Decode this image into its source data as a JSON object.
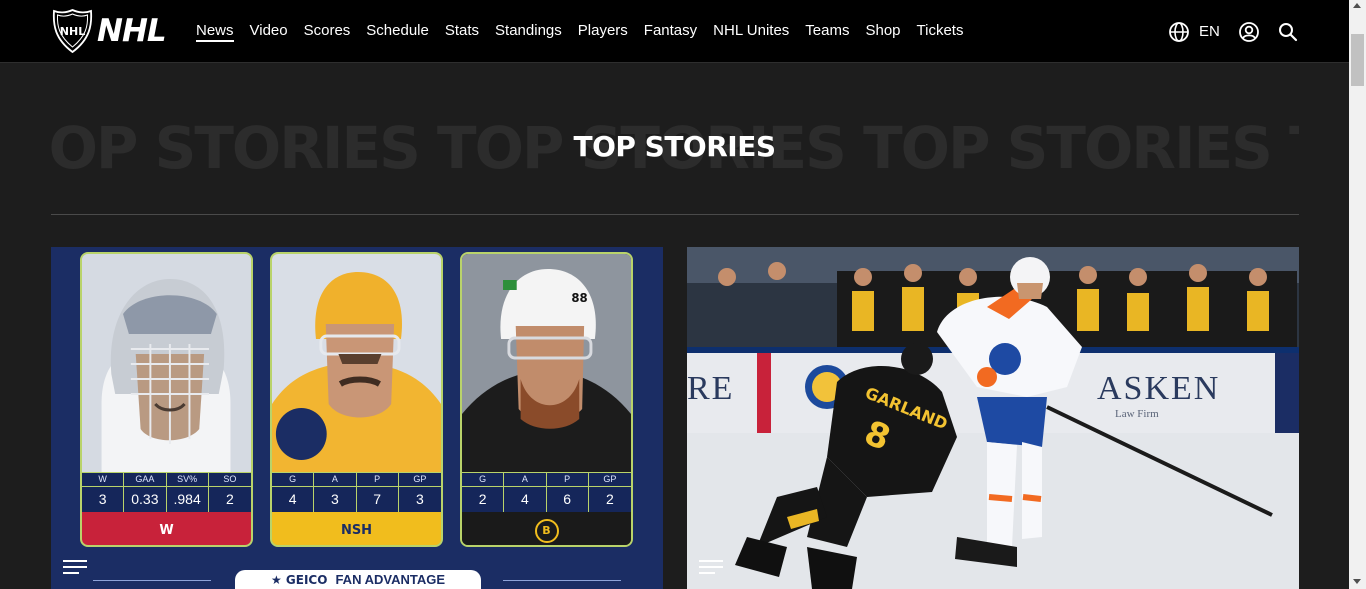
{
  "header": {
    "logo_text": "NHL",
    "nav": [
      {
        "label": "News",
        "active": true
      },
      {
        "label": "Video"
      },
      {
        "label": "Scores"
      },
      {
        "label": "Schedule"
      },
      {
        "label": "Stats"
      },
      {
        "label": "Standings"
      },
      {
        "label": "Players"
      },
      {
        "label": "Fantasy"
      },
      {
        "label": "NHL Unites"
      },
      {
        "label": "Teams"
      },
      {
        "label": "Shop"
      },
      {
        "label": "Tickets"
      }
    ],
    "language": "EN",
    "icons": {
      "language": "globe-icon",
      "account": "user-circle-icon",
      "search": "search-icon"
    }
  },
  "section": {
    "title": "TOP STORIES",
    "background_text": "TOP STORIES TOP STORIES TOP STORIES TOP STORIES"
  },
  "cards": [
    {
      "type": "graphic",
      "menu_icon": "hamburger-menu-icon",
      "panels": [
        {
          "stat_labels": [
            "W",
            "GAA",
            "SV%",
            "SO"
          ],
          "stat_values": [
            "3",
            "0.33",
            ".984",
            "2"
          ],
          "team_mark": "W"
        },
        {
          "stat_labels": [
            "G",
            "A",
            "P",
            "GP"
          ],
          "stat_values": [
            "4",
            "3",
            "7",
            "3"
          ],
          "team_mark": "NSH"
        },
        {
          "stat_labels": [
            "G",
            "A",
            "P",
            "GP"
          ],
          "stat_values": [
            "2",
            "4",
            "6",
            "2"
          ],
          "team_mark": "B"
        }
      ],
      "sponsor": {
        "brand": "★ GEICO",
        "text": "FAN ADVANTAGE"
      }
    },
    {
      "type": "photo",
      "menu_icon": "hamburger-menu-icon",
      "board_text": "ASKEN",
      "board_sub": "Law Firm",
      "board_left": "RE",
      "jersey_name": "GARLAND",
      "jersey_number": "8"
    }
  ],
  "colors": {
    "header_bg": "#000000",
    "page_bg": "#1d1d1d",
    "accent_lime": "#b9d36a",
    "navy": "#1b2d64"
  }
}
